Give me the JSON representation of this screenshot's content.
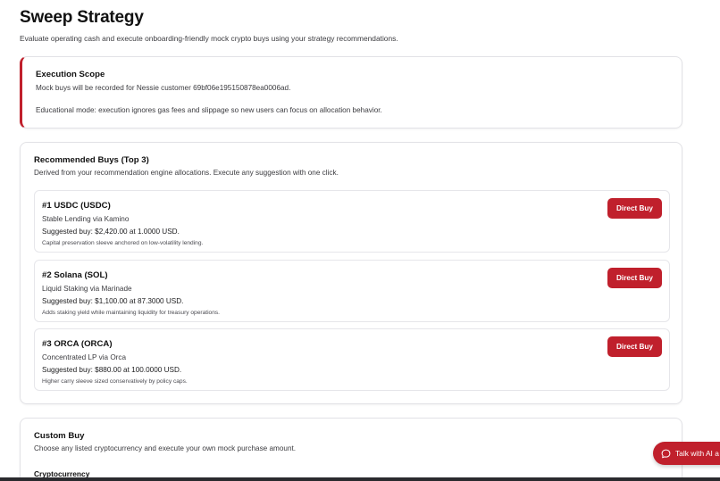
{
  "header": {
    "title": "Sweep Strategy",
    "subtitle": "Evaluate operating cash and execute onboarding-friendly mock crypto buys using your strategy recommendations."
  },
  "scope": {
    "title": "Execution Scope",
    "line1": "Mock buys will be recorded for Nessie customer 69bf06e195150878ea0006ad.",
    "line2": "Educational mode: execution ignores gas fees and slippage so new users can focus on allocation behavior."
  },
  "recommended": {
    "title": "Recommended Buys (Top 3)",
    "description": "Derived from your recommendation engine allocations. Execute any suggestion with one click.",
    "button_label": "Direct Buy",
    "items": [
      {
        "name": "#1 USDC (USDC)",
        "strategy": "Stable Lending via Kamino",
        "suggestion": "Suggested buy: $2,420.00 at 1.0000 USD.",
        "note": "Capital preservation sleeve anchored on low-volatility lending."
      },
      {
        "name": "#2 Solana (SOL)",
        "strategy": "Liquid Staking via Marinade",
        "suggestion": "Suggested buy: $1,100.00 at 87.3000 USD.",
        "note": "Adds staking yield while maintaining liquidity for treasury operations."
      },
      {
        "name": "#3 ORCA (ORCA)",
        "strategy": "Concentrated LP via Orca",
        "suggestion": "Suggested buy: $880.00 at 100.0000 USD.",
        "note": "Higher carry sleeve sized conservatively by policy caps."
      }
    ]
  },
  "custom": {
    "title": "Custom Buy",
    "description": "Choose any listed cryptocurrency and execute your own mock purchase amount.",
    "crypto_label": "Cryptocurrency"
  },
  "chat": {
    "label": "Talk with AI a",
    "icon": "chat-bubble-icon"
  },
  "colors": {
    "accent": "#c0202c",
    "border": "#e2e2e6",
    "text": "#1c1c1e"
  }
}
